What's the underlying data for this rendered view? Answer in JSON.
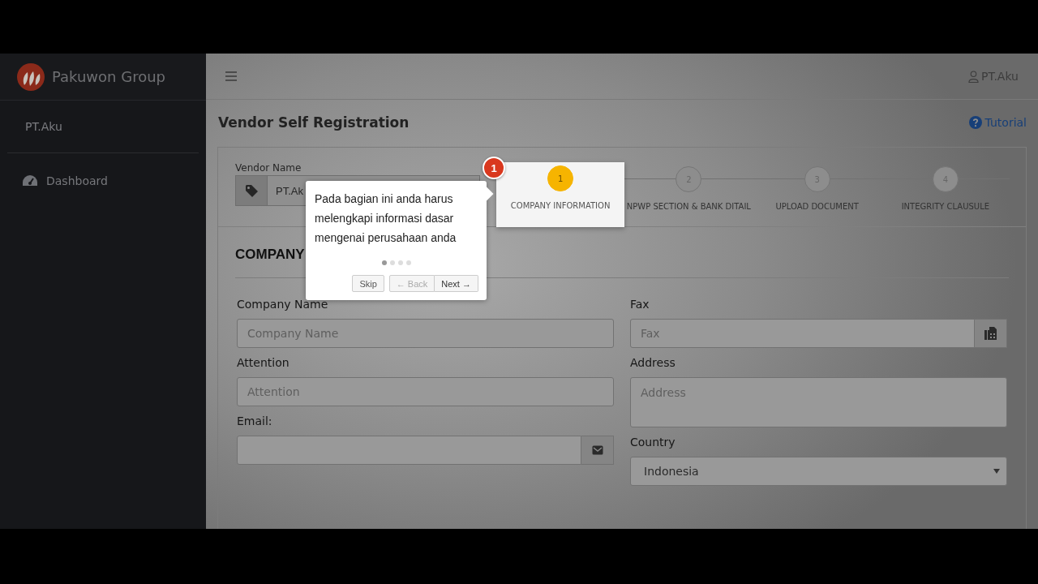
{
  "brand": {
    "name": "Pakuwon Group"
  },
  "sidebar": {
    "user": "PT.Aku",
    "items": [
      {
        "label": "Dashboard",
        "selected": false
      }
    ]
  },
  "topbar": {
    "user": "PT.Aku"
  },
  "page": {
    "title": "Vendor Self Registration",
    "help_link": "Tutorial"
  },
  "vendor": {
    "label": "Vendor Name",
    "value": "PT.Ak"
  },
  "steps": [
    {
      "number": "1",
      "label": "COMPANY INFORMATION",
      "selected": true
    },
    {
      "number": "2",
      "label": "NPWP SECTION & BANK DITAIL",
      "selected": false
    },
    {
      "number": "3",
      "label": "UPLOAD DOCUMENT",
      "selected": false
    },
    {
      "number": "4",
      "label": "INTEGRITY CLAUSULE",
      "selected": false
    }
  ],
  "tour": {
    "badge": "1",
    "text": "Pada bagian ini anda harus melengkapi informasi dasar mengenai perusahaan anda",
    "dots": [
      {
        "selected": true
      },
      {
        "selected": false
      },
      {
        "selected": false
      },
      {
        "selected": false
      }
    ],
    "buttons": [
      {
        "label": "Skip",
        "disabled": false
      },
      {
        "label": "← Back",
        "disabled": true
      },
      {
        "label": "Next →",
        "disabled": false
      }
    ]
  },
  "section": {
    "title": "COMPANY"
  },
  "left_fields": [
    {
      "label": "Company Name",
      "placeholder": "Company Name",
      "kind": "text"
    },
    {
      "label": "Attention",
      "placeholder": "Attention",
      "kind": "text"
    },
    {
      "label": "Email:",
      "kind": "email"
    }
  ],
  "right_fields": [
    {
      "label": "Fax",
      "placeholder": "Fax",
      "kind": "fax"
    },
    {
      "label": "Address",
      "placeholder": "Address",
      "kind": "textarea"
    },
    {
      "label": "Country",
      "value": "Indonesia",
      "kind": "select"
    }
  ]
}
